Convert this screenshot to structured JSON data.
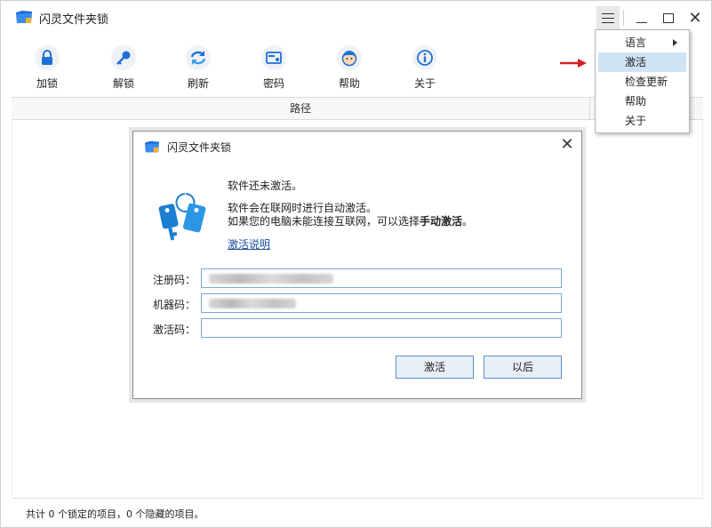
{
  "app": {
    "title": "闪灵文件夹锁",
    "brand_color": "#1e6fd9"
  },
  "window_controls": {
    "menu_icon": "hamburger-icon",
    "minimize_icon": "minimize-icon",
    "maximize_icon": "maximize-icon",
    "close_icon": "close-icon"
  },
  "toolbar": {
    "items": [
      {
        "label": "加锁",
        "icon": "lock-icon"
      },
      {
        "label": "解锁",
        "icon": "key-icon"
      },
      {
        "label": "刷新",
        "icon": "refresh-icon"
      },
      {
        "label": "密码",
        "icon": "password-card-icon"
      },
      {
        "label": "帮助",
        "icon": "help-face-icon"
      },
      {
        "label": "关于",
        "icon": "info-icon"
      }
    ]
  },
  "list": {
    "column_path": "路径"
  },
  "status": {
    "text": "共计 0 个锁定的项目，0 个隐藏的项目。"
  },
  "menu": {
    "items": [
      {
        "label": "语言",
        "has_submenu": true
      },
      {
        "label": "激活",
        "active": true
      },
      {
        "label": "检查更新"
      },
      {
        "label": "帮助"
      },
      {
        "label": "关于"
      }
    ]
  },
  "dialog": {
    "title": "闪灵文件夹锁",
    "line1": "软件还未激活。",
    "line2": "软件会在联网时进行自动激活。",
    "line3_prefix": "如果您的电脑未能连接互联网，可以选择",
    "line3_bold": "手动激活",
    "line3_suffix": "。",
    "help_link": "激活说明",
    "fields": {
      "reg_label": "注册码：",
      "machine_label": "机器码：",
      "activation_label": "激活码：",
      "activation_value": ""
    },
    "buttons": {
      "activate": "激活",
      "later": "以后"
    }
  },
  "annotation_color": "#d42020"
}
